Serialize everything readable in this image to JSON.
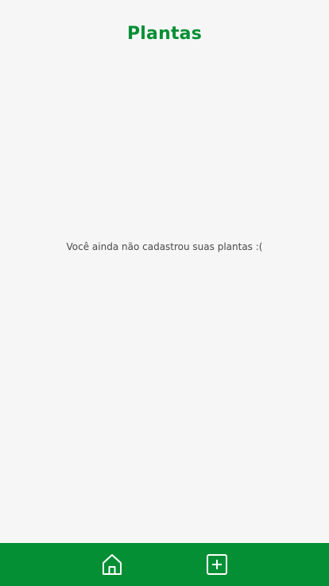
{
  "header": {
    "title": "Plantas"
  },
  "main": {
    "empty_message": "Você ainda não cadastrou suas plantas :("
  },
  "bottom_nav": {
    "items": [
      {
        "icon": "home-icon"
      },
      {
        "icon": "add-square-icon"
      }
    ]
  },
  "colors": {
    "brand": "#058f35",
    "background": "#f6f6f6",
    "text": "#4a4a4a"
  }
}
